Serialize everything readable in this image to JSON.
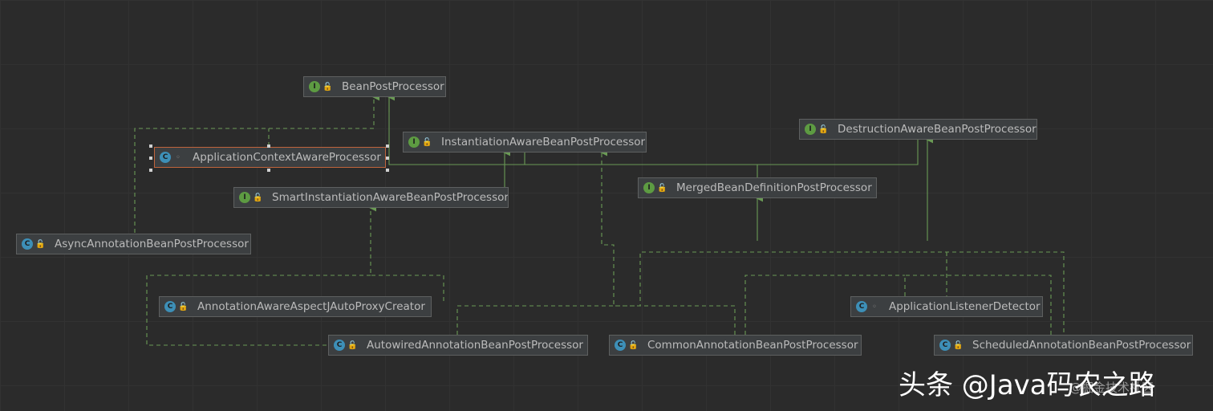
{
  "nodes": {
    "bean_post_processor": {
      "label": "BeanPostProcessor",
      "kind": "interface",
      "badge": "I"
    },
    "instantiation_aware": {
      "label": "InstantiationAwareBeanPostProcessor",
      "kind": "interface",
      "badge": "I"
    },
    "destruction_aware": {
      "label": "DestructionAwareBeanPostProcessor",
      "kind": "interface",
      "badge": "I"
    },
    "application_context_aware": {
      "label": "ApplicationContextAwareProcessor",
      "kind": "class",
      "badge": "C"
    },
    "smart_instantiation_aware": {
      "label": "SmartInstantiationAwareBeanPostProcessor",
      "kind": "interface",
      "badge": "I"
    },
    "merged_bean_definition": {
      "label": "MergedBeanDefinitionPostProcessor",
      "kind": "interface",
      "badge": "I"
    },
    "async_annotation": {
      "label": "AsyncAnnotationBeanPostProcessor",
      "kind": "class",
      "badge": "C"
    },
    "annotation_aware_aspectj": {
      "label": "AnnotationAwareAspectJAutoProxyCreator",
      "kind": "class",
      "badge": "C"
    },
    "application_listener_detector": {
      "label": "ApplicationListenerDetector",
      "kind": "class",
      "badge": "C"
    },
    "autowired_annotation": {
      "label": "AutowiredAnnotationBeanPostProcessor",
      "kind": "class",
      "badge": "C"
    },
    "common_annotation": {
      "label": "CommonAnnotationBeanPostProcessor",
      "kind": "class",
      "badge": "C"
    },
    "scheduled_annotation": {
      "label": "ScheduledAnnotationBeanPostProcessor",
      "kind": "class",
      "badge": "C"
    }
  },
  "colors": {
    "background": "#2b2b2b",
    "node_fill": "#3c3f41",
    "edge": "#6a9a55",
    "interface_badge": "#5d9b42",
    "class_badge": "#3d8fb7",
    "selection": "#c0643c"
  },
  "watermark": {
    "main": "头条 @Java码农之路",
    "sub": "@掘金技术社区"
  }
}
